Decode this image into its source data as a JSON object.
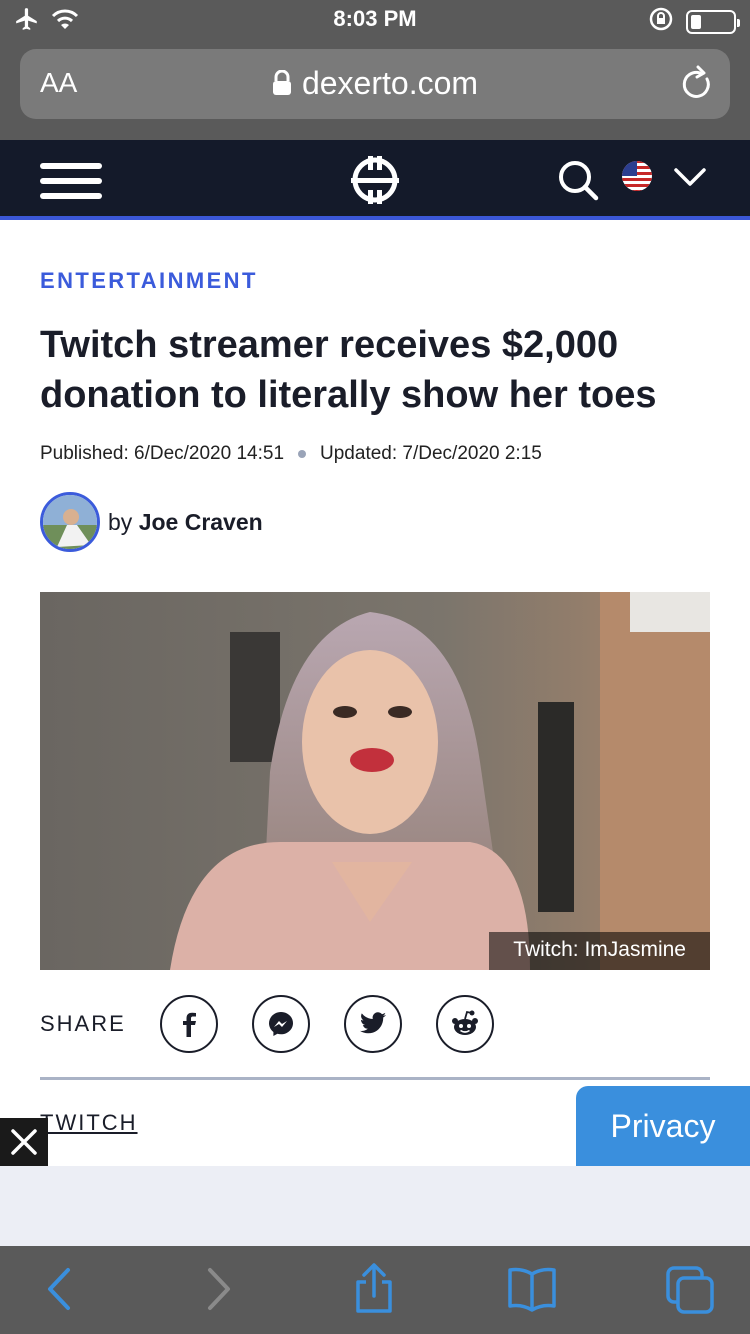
{
  "status_bar": {
    "time": "8:03 PM"
  },
  "browser": {
    "text_size_label": "AA",
    "url": "dexerto.com"
  },
  "article": {
    "category": "ENTERTAINMENT",
    "headline": "Twitch streamer receives $2,000 donation to literally show her toes",
    "published": "Published: 6/Dec/2020 14:51",
    "updated": "Updated: 7/Dec/2020 2:15",
    "author_prefix": "by",
    "author_name": "Joe Craven",
    "photo_credit": "Twitch: ImJasmine",
    "share_label": "SHARE",
    "tag": "TWITCH"
  },
  "privacy_label": "Privacy",
  "icons": [
    "airplane-icon",
    "wifi-icon",
    "orientation-lock-icon",
    "battery-icon",
    "lock-icon",
    "reload-icon",
    "menu-icon",
    "dexerto-logo-icon",
    "search-icon",
    "us-flag-icon",
    "chevron-down-icon",
    "facebook-icon",
    "messenger-icon",
    "twitter-icon",
    "reddit-icon",
    "close-icon",
    "back-icon",
    "forward-icon",
    "share-icon",
    "bookmarks-icon",
    "tabs-icon"
  ],
  "colors": {
    "accent": "#3b5bdb",
    "header_bg": "#141a2a",
    "privacy_bg": "#3a8fdd"
  }
}
